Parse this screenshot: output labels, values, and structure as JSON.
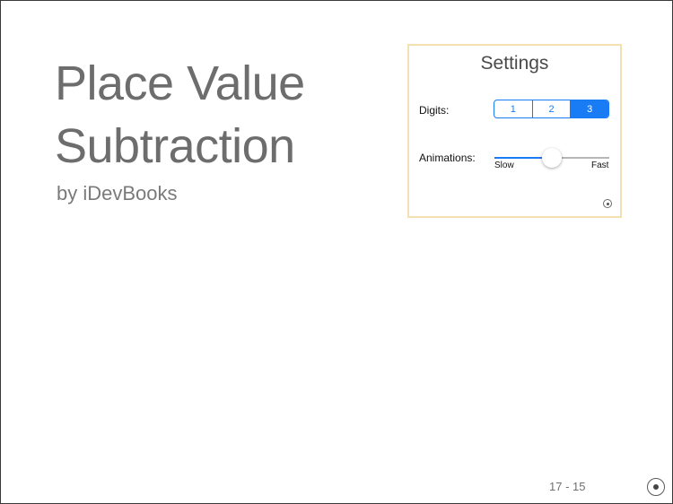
{
  "title": {
    "line1": "Place Value",
    "line2": "Subtraction"
  },
  "byline": "by iDevBooks",
  "settings": {
    "title": "Settings",
    "digits": {
      "label": "Digits:",
      "options": [
        "1",
        "2",
        "3"
      ],
      "selected": "3"
    },
    "animations": {
      "label": "Animations:",
      "min_label": "Slow",
      "max_label": "Fast",
      "value": 0.5
    },
    "dot_button_icon": "radio-dot-icon"
  },
  "page_indicator": "17 - 15",
  "corner_button_icon": "radio-dot-icon",
  "colors": {
    "accent": "#1a7cf5",
    "title_text": "#6d6d6d",
    "settings_border": "#f5e0b4"
  }
}
